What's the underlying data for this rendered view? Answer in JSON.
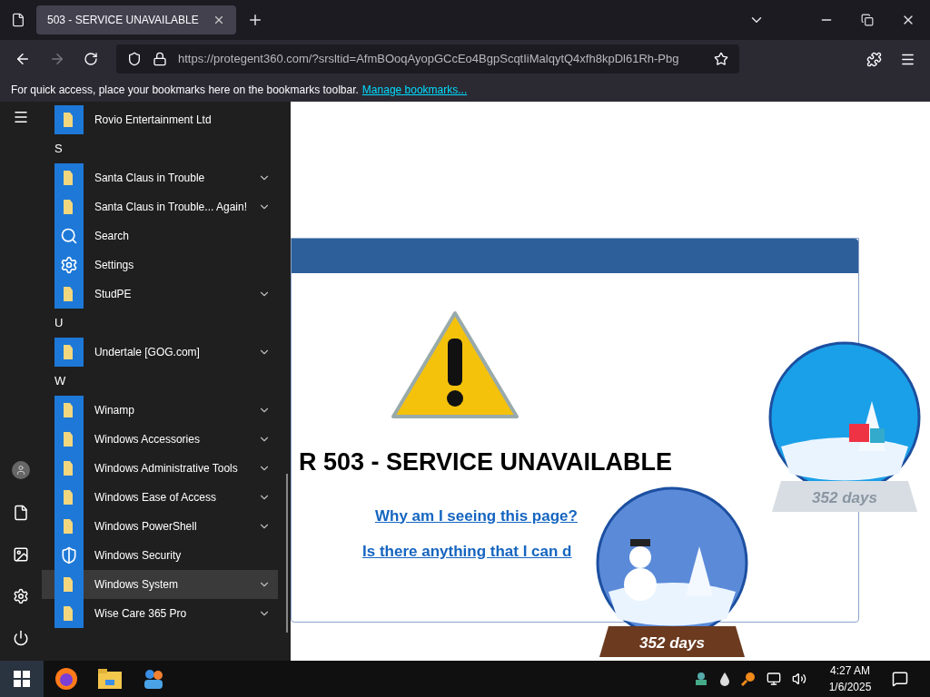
{
  "browser": {
    "tab": {
      "title": "503 - SERVICE UNAVAILABLE",
      "selected": true
    },
    "url": "https://protegent360.com/?srsltid=AfmBOoqAyopGCcEo4BgpScqtIiMalqytQ4xfh8kpDl61Rh-Pbg",
    "bookmarks_hint": "For quick access, place your bookmarks here on the bookmarks toolbar.",
    "bookmarks_link": "Manage bookmarks..."
  },
  "page": {
    "heading": "R 503 - SERVICE UNAVAILABLE",
    "links": [
      "Why am I seeing this page?",
      "Is there anything that I can d"
    ],
    "globes": [
      {
        "kind": "wood",
        "label": "352 days"
      },
      {
        "kind": "silver",
        "label": "352 days"
      }
    ]
  },
  "start_menu": {
    "items": [
      {
        "kind": "folder",
        "label": "Rovio Entertainment Ltd",
        "expandable": false,
        "selected": false
      },
      {
        "kind": "header",
        "label": "S"
      },
      {
        "kind": "folder",
        "label": "Santa Claus in Trouble",
        "expandable": true,
        "selected": false
      },
      {
        "kind": "folder",
        "label": "Santa Claus in Trouble... Again!",
        "expandable": true,
        "selected": false
      },
      {
        "kind": "search",
        "label": "Search",
        "expandable": false,
        "selected": false
      },
      {
        "kind": "gear",
        "label": "Settings",
        "expandable": false,
        "selected": false
      },
      {
        "kind": "folder",
        "label": "StudPE",
        "expandable": true,
        "selected": false
      },
      {
        "kind": "header",
        "label": "U"
      },
      {
        "kind": "folder",
        "label": "Undertale [GOG.com]",
        "expandable": true,
        "selected": false
      },
      {
        "kind": "header",
        "label": "W"
      },
      {
        "kind": "folder",
        "label": "Winamp",
        "expandable": true,
        "selected": false
      },
      {
        "kind": "folder",
        "label": "Windows Accessories",
        "expandable": true,
        "selected": false
      },
      {
        "kind": "folder",
        "label": "Windows Administrative Tools",
        "expandable": true,
        "selected": false
      },
      {
        "kind": "folder",
        "label": "Windows Ease of Access",
        "expandable": true,
        "selected": false
      },
      {
        "kind": "folder",
        "label": "Windows PowerShell",
        "expandable": true,
        "selected": false
      },
      {
        "kind": "shield",
        "label": "Windows Security",
        "expandable": false,
        "selected": false
      },
      {
        "kind": "folder",
        "label": "Windows System",
        "expandable": true,
        "selected": true
      },
      {
        "kind": "folder",
        "label": "Wise Care 365 Pro",
        "expandable": true,
        "selected": false
      }
    ]
  },
  "taskbar": {
    "time": "4:27 AM",
    "date": "1/6/2025"
  }
}
